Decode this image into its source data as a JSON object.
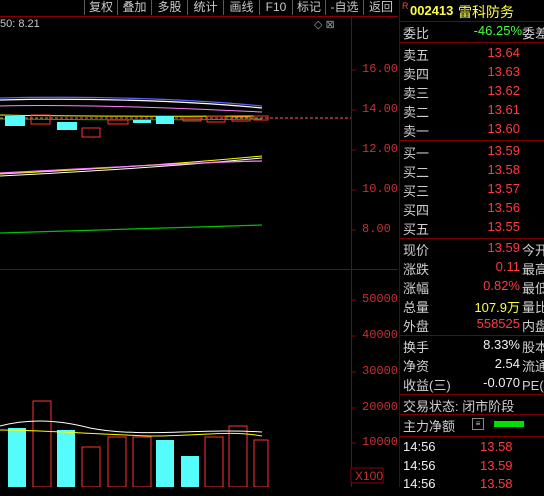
{
  "toolbar": {
    "buttons": [
      "复权",
      "叠加",
      "多股",
      "统计",
      "画线",
      "F10",
      "-自选",
      "返回"
    ]
  },
  "chart": {
    "ma_label": "50: 8.21",
    "price_ticks": [
      "16.00",
      "14.00",
      "12.00",
      "10.00",
      "8.00"
    ],
    "volume_ticks": [
      "50000",
      "40000",
      "30000",
      "20000",
      "10000"
    ],
    "volume_unit": "X100",
    "colors": {
      "up": "#ff3232",
      "down": "#54fcfc",
      "ma_white": "#ffffff",
      "ma_yellow": "#ffff00",
      "ma_purple": "#ff80ff",
      "ma_green": "#00c000",
      "ma_blue": "#6060ff"
    }
  },
  "quote": {
    "flag": "R",
    "code": "002413",
    "name": "雷科防务",
    "ratio_label": "委比",
    "ratio_value": "-46.25%",
    "ratio_extra": "委差",
    "asks": [
      {
        "label": "卖五",
        "price": "13.64"
      },
      {
        "label": "卖四",
        "price": "13.63"
      },
      {
        "label": "卖三",
        "price": "13.62"
      },
      {
        "label": "卖二",
        "price": "13.61"
      },
      {
        "label": "卖一",
        "price": "13.60"
      }
    ],
    "bids": [
      {
        "label": "买一",
        "price": "13.59"
      },
      {
        "label": "买二",
        "price": "13.58"
      },
      {
        "label": "买三",
        "price": "13.57"
      },
      {
        "label": "买四",
        "price": "13.56"
      },
      {
        "label": "买五",
        "price": "13.55"
      }
    ],
    "stats": [
      {
        "label": "现价",
        "value": "13.59",
        "extra": "今开"
      },
      {
        "label": "涨跌",
        "value": "0.11",
        "extra": "最高"
      },
      {
        "label": "涨幅",
        "value": "0.82%",
        "extra": "最低"
      },
      {
        "label": "总量",
        "value": "107.9万",
        "extra": "量比"
      },
      {
        "label": "外盘",
        "value": "558525",
        "extra": "内盘"
      }
    ],
    "fundamentals": [
      {
        "label": "换手",
        "value": "8.33%",
        "extra": "股本"
      },
      {
        "label": "净资",
        "value": "2.54",
        "extra": "流通"
      },
      {
        "label": "收益(三)",
        "value": "-0.070",
        "extra": "PE(动"
      }
    ],
    "trade_status": "交易状态: 闭市阶段",
    "main_flow_label": "主力净额",
    "ticks": [
      {
        "time": "14:56",
        "price": "13.58"
      },
      {
        "time": "14:56",
        "price": "13.59"
      },
      {
        "time": "14:56",
        "price": "13.58"
      }
    ]
  }
}
